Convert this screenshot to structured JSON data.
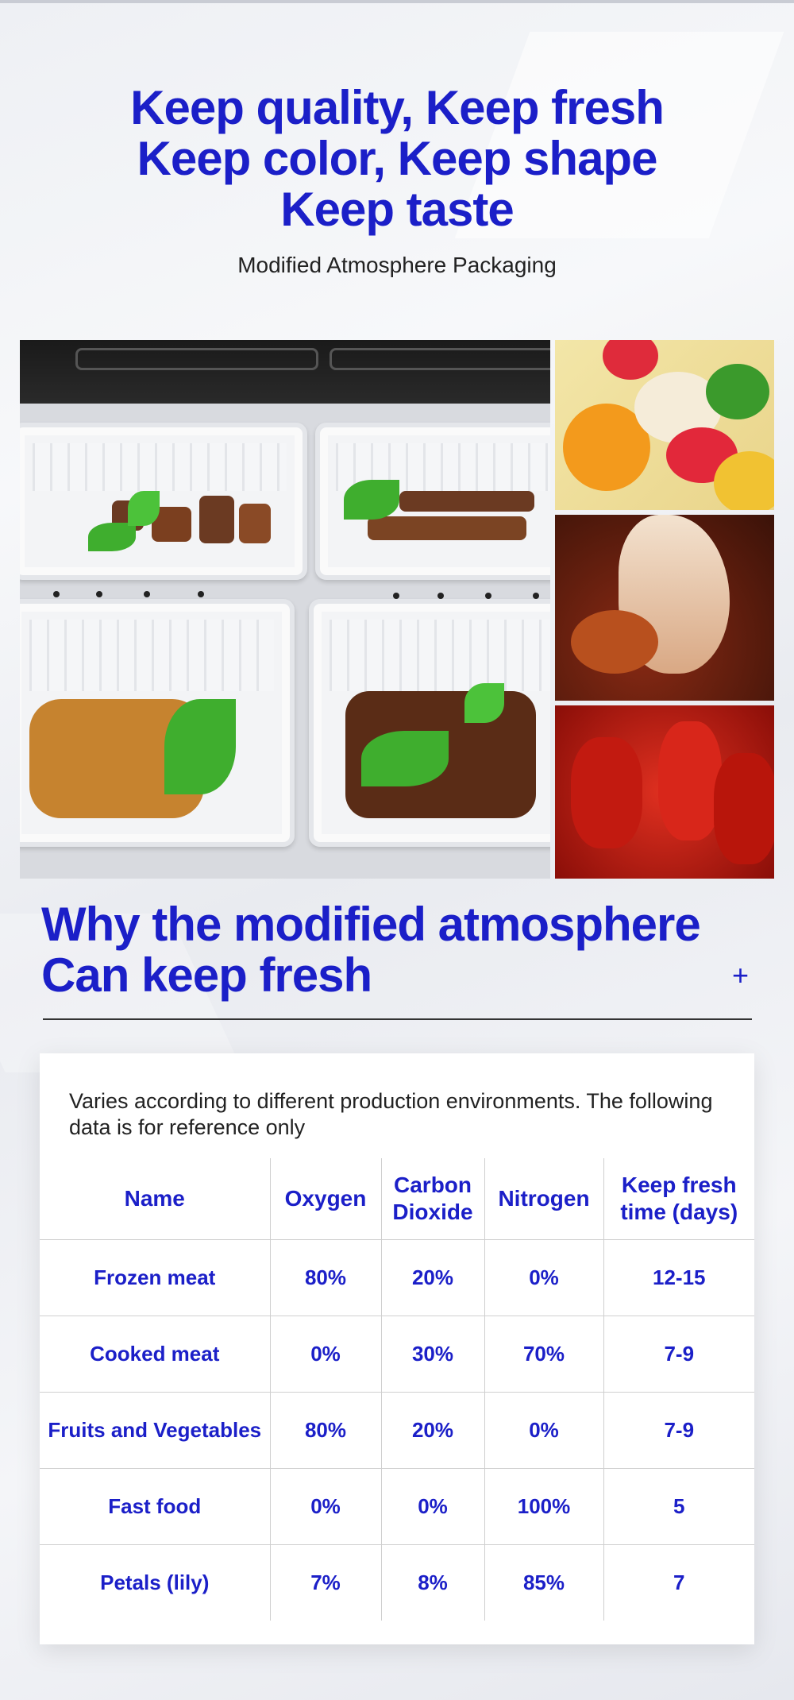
{
  "hero": {
    "title_lines": [
      "Keep quality, Keep fresh",
      "Keep color, Keep shape",
      "Keep taste"
    ],
    "subtitle": "Modified Atmosphere Packaging"
  },
  "photos": {
    "main": "packaged-cooked-food-trays-image",
    "side": [
      "fruit-salad-image",
      "roast-duck-image",
      "crayfish-image"
    ]
  },
  "why": {
    "title_lines": [
      "Why the modified atmosphere",
      "Can keep fresh"
    ],
    "toggle_symbol": "+",
    "toggle_icon": "plus-icon"
  },
  "table": {
    "note": "Varies according to different production environments. The following data is for reference only",
    "headers": [
      "Name",
      "Oxygen",
      "Carbon Dioxide",
      "Nitrogen",
      "Keep fresh time (days)"
    ],
    "rows": [
      [
        "Frozen meat",
        "80%",
        "20%",
        "0%",
        "12-15"
      ],
      [
        "Cooked meat",
        "0%",
        "30%",
        "70%",
        "7-9"
      ],
      [
        "Fruits and Vegetables",
        "80%",
        "20%",
        "0%",
        "7-9"
      ],
      [
        "Fast food",
        "0%",
        "0%",
        "100%",
        "5"
      ],
      [
        "Petals (lily)",
        "7%",
        "8%",
        "85%",
        "7"
      ]
    ]
  },
  "colors": {
    "accent": "#1b1fc8",
    "text": "#222222",
    "card": "#ffffff"
  }
}
